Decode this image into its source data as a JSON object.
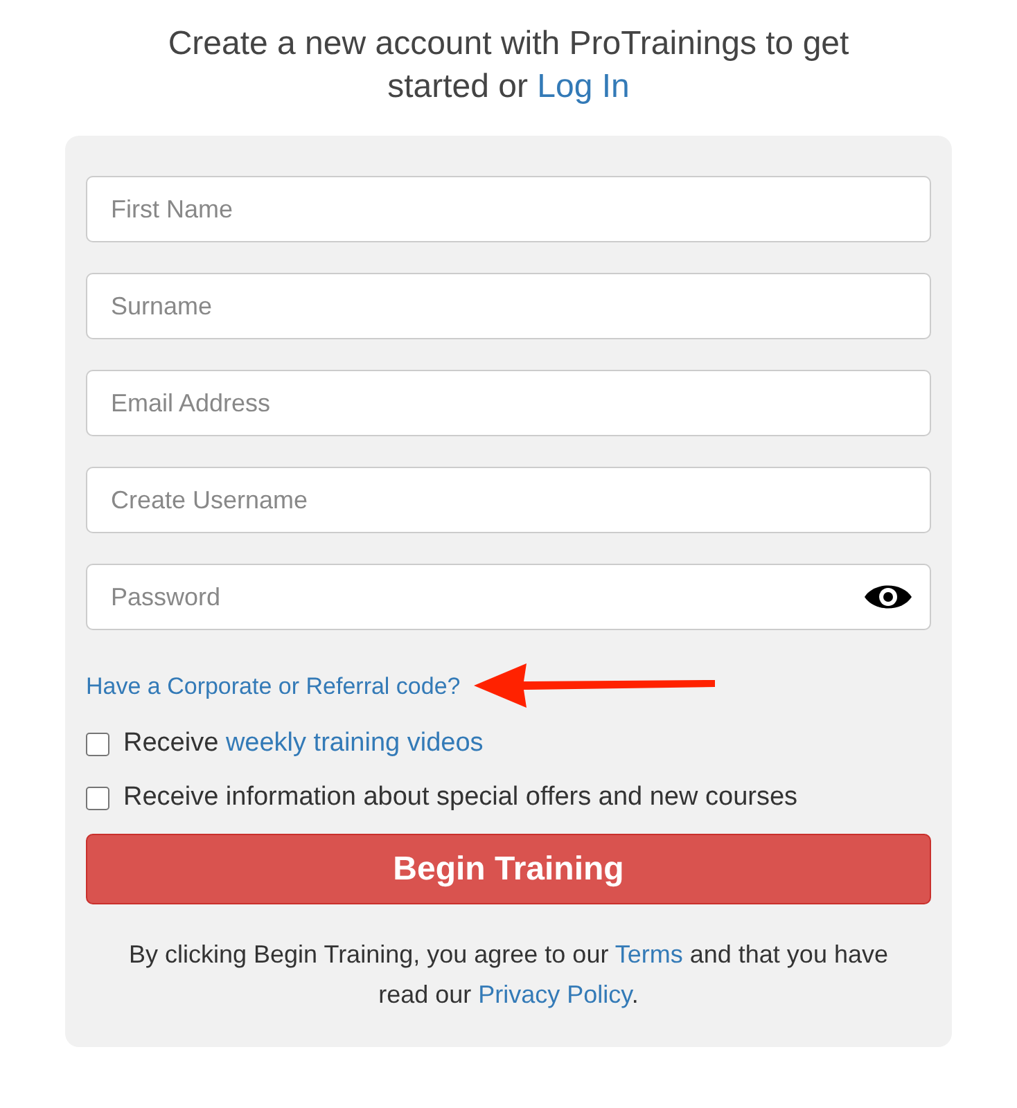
{
  "heading": {
    "text": "Create a new account with ProTrainings to get started or",
    "link": "Log In"
  },
  "fields": [
    {
      "placeholder": "First Name",
      "kind": "text"
    },
    {
      "placeholder": "Surname",
      "kind": "text"
    },
    {
      "placeholder": "Email Address",
      "kind": "text"
    },
    {
      "placeholder": "Create Username",
      "kind": "text"
    },
    {
      "placeholder": "Password",
      "kind": "password"
    }
  ],
  "code_link": "Have a Corporate or Referral code?",
  "checkboxes": [
    {
      "text": "Receive",
      "link": "weekly training videos",
      "checked": false
    },
    {
      "text": "Receive information about special offers and new courses",
      "checked": false
    }
  ],
  "submit": "Begin Training",
  "terms": {
    "before": "By clicking Begin Training, you agree to our",
    "terms_link": "Terms",
    "middle": "and that you have read our",
    "privacy_link": "Privacy Policy",
    "after": "."
  }
}
